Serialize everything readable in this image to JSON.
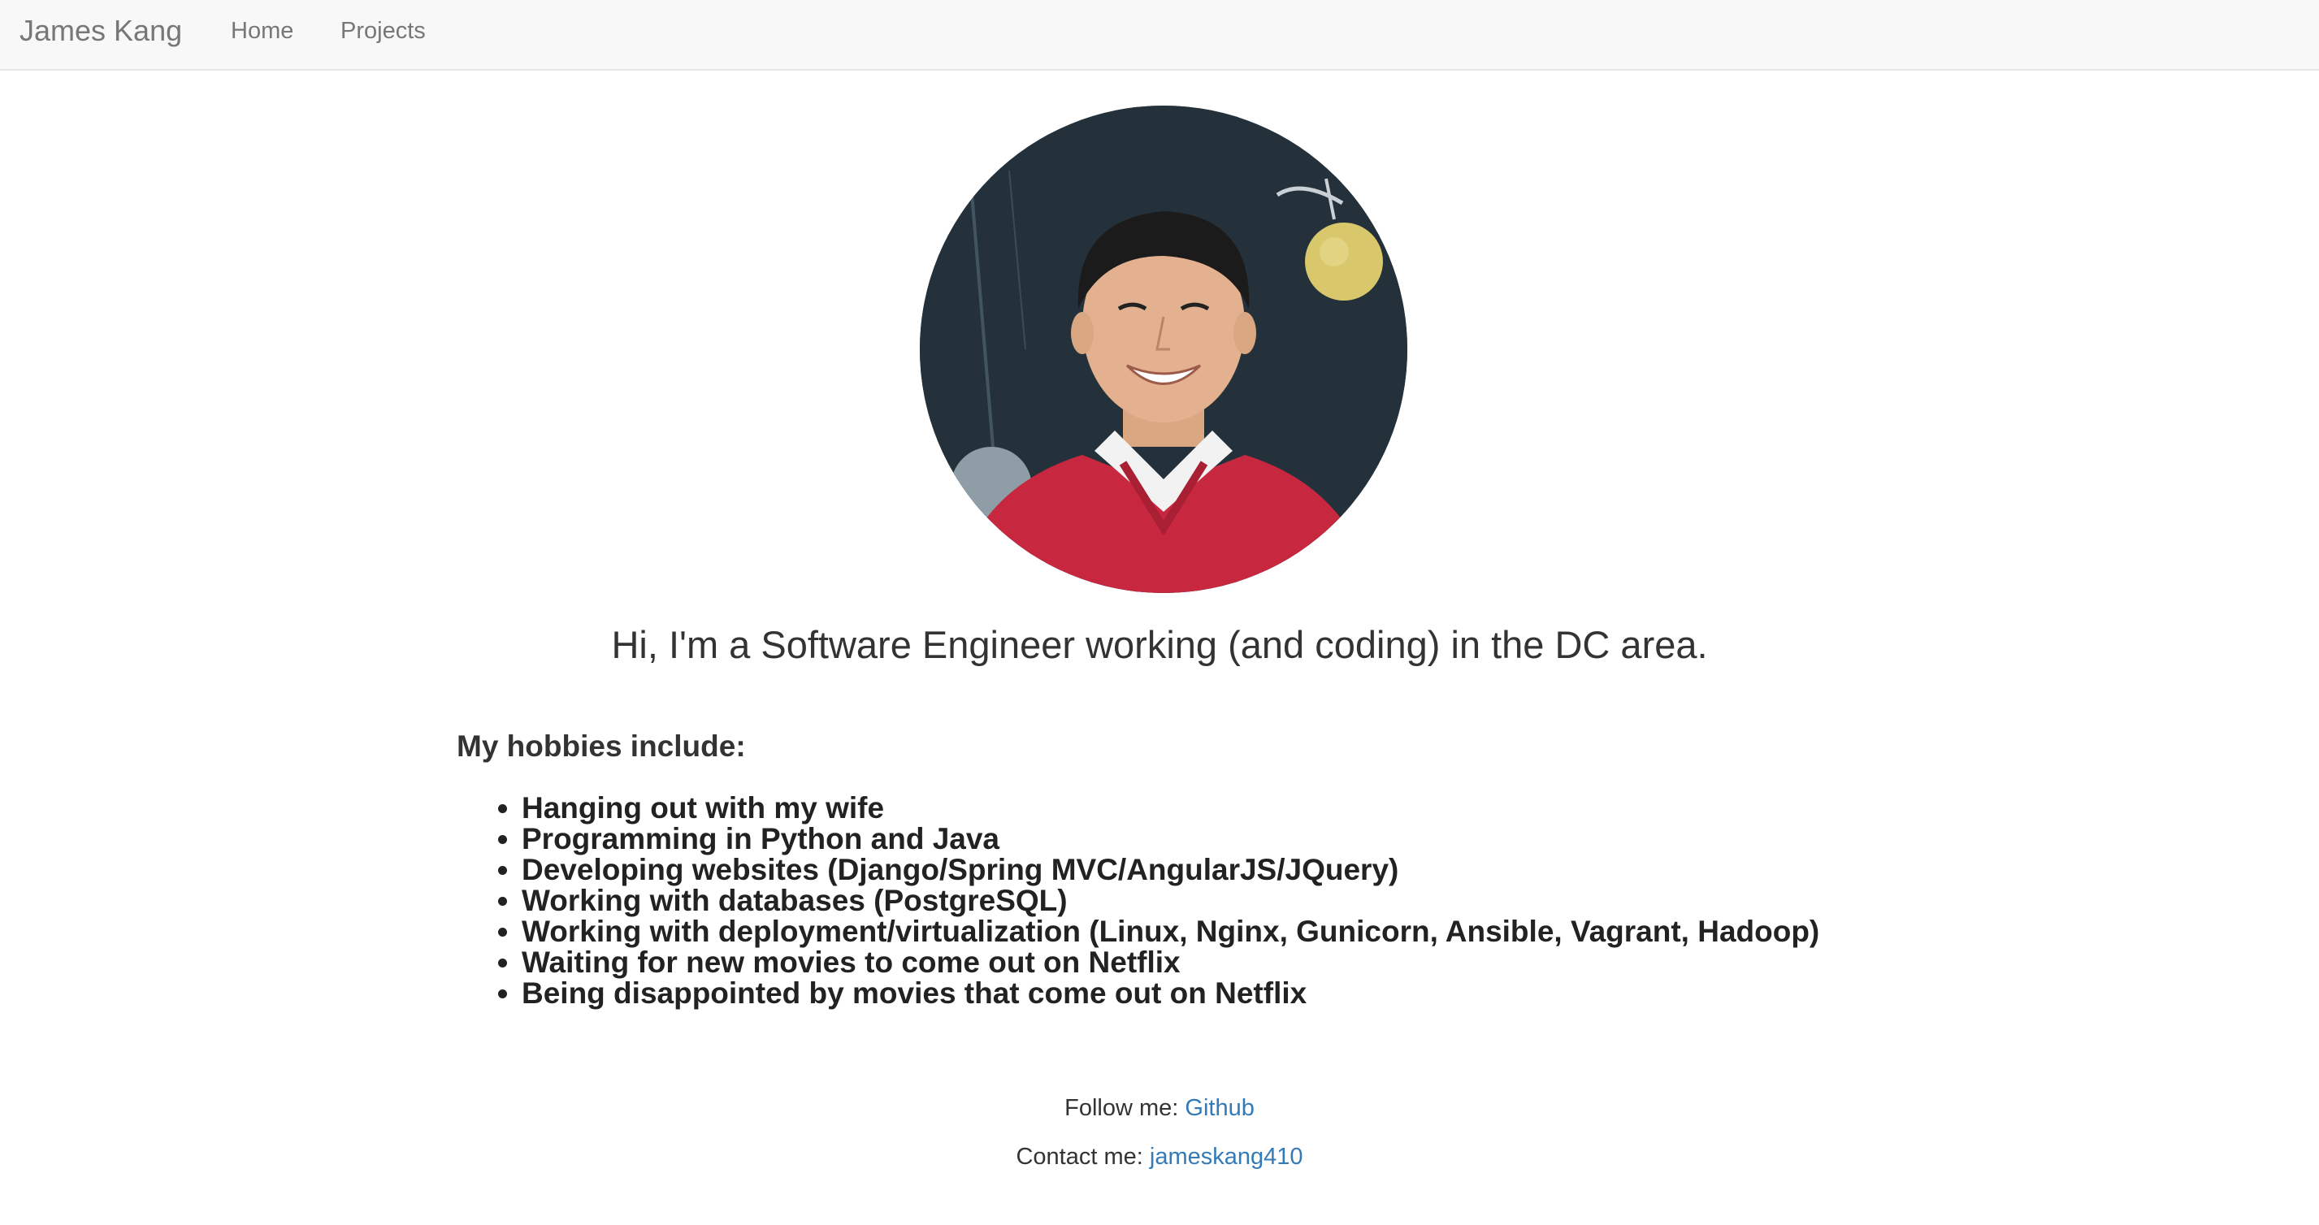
{
  "navbar": {
    "brand": "James Kang",
    "links": [
      {
        "label": "Home"
      },
      {
        "label": "Projects"
      }
    ]
  },
  "profile": {
    "intro": "Hi, I'm a Software Engineer working (and coding) in the DC area.",
    "hobbies_title": "My hobbies include:",
    "hobbies": [
      "Hanging out with my wife",
      "Programming in Python and Java",
      "Developing websites (Django/Spring MVC/AngularJS/JQuery)",
      "Working with databases (PostgreSQL)",
      "Working with deployment/virtualization (Linux, Nginx, Gunicorn, Ansible, Vagrant, Hadoop)",
      "Waiting for new movies to come out on Netflix",
      "Being disappointed by movies that come out on Netflix"
    ]
  },
  "footer": {
    "follow_label": "Follow me: ",
    "follow_link": "Github",
    "contact_label": "Contact me: ",
    "contact_link": "jameskang410"
  },
  "colors": {
    "link": "#337ab7",
    "navbar_bg": "#f8f8f8",
    "nav_text": "#777777",
    "sweater": "#c8283f"
  }
}
